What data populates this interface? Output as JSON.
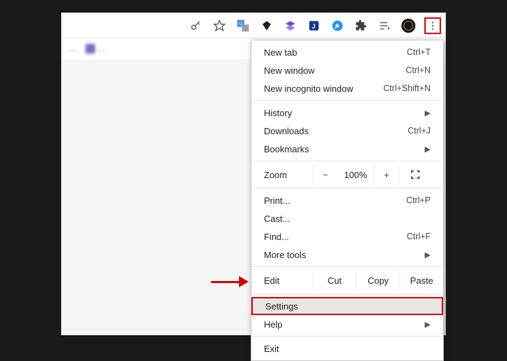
{
  "toolbar": {
    "icons": [
      "key-icon",
      "star-icon",
      "translate-icon",
      "gem-icon",
      "stack-icon",
      "shield-j-icon",
      "wrench-icon",
      "puzzle-icon",
      "playlist-icon",
      "avatar-icon"
    ]
  },
  "bookmarks": [
    {
      "label": "…"
    },
    {
      "label": "…"
    }
  ],
  "menu": {
    "new_tab": {
      "label": "New tab",
      "shortcut": "Ctrl+T"
    },
    "new_window": {
      "label": "New window",
      "shortcut": "Ctrl+N"
    },
    "new_incognito": {
      "label": "New incognito window",
      "shortcut": "Ctrl+Shift+N"
    },
    "history": {
      "label": "History"
    },
    "downloads": {
      "label": "Downloads",
      "shortcut": "Ctrl+J"
    },
    "bookmarks": {
      "label": "Bookmarks"
    },
    "zoom": {
      "label": "Zoom",
      "value": "100%",
      "minus": "−",
      "plus": "+"
    },
    "print": {
      "label": "Print...",
      "shortcut": "Ctrl+P"
    },
    "cast": {
      "label": "Cast..."
    },
    "find": {
      "label": "Find...",
      "shortcut": "Ctrl+F"
    },
    "more_tools": {
      "label": "More tools"
    },
    "edit": {
      "label": "Edit",
      "cut": "Cut",
      "copy": "Copy",
      "paste": "Paste"
    },
    "settings": {
      "label": "Settings"
    },
    "help": {
      "label": "Help"
    },
    "exit": {
      "label": "Exit"
    }
  }
}
